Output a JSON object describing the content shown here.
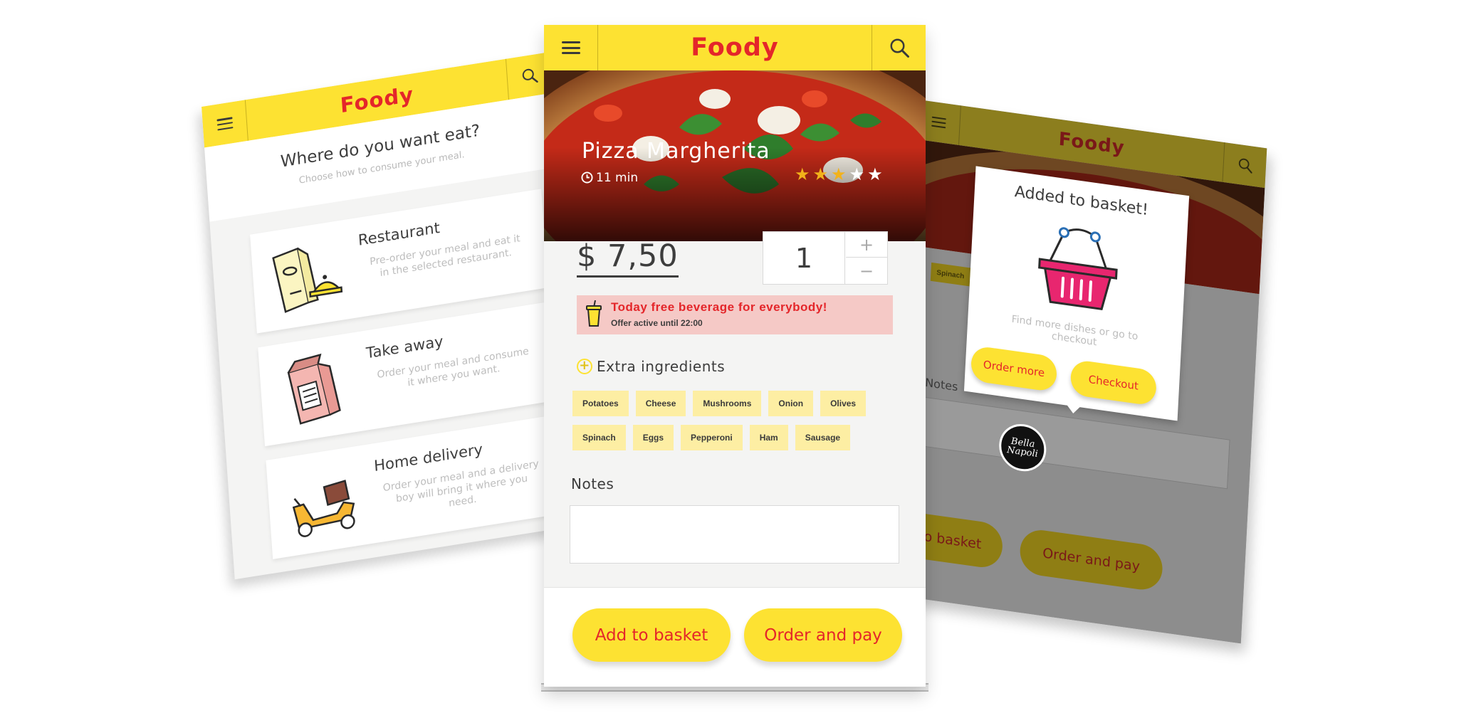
{
  "app": {
    "brand": "Foody"
  },
  "center": {
    "dish_title": "Pizza Margherita",
    "time": "11 min",
    "rating": {
      "value": 3,
      "max": 5
    },
    "price": "$ 7,50",
    "quantity": "1",
    "plus": "+",
    "minus": "−",
    "promo_title": "Today free beverage for everybody!",
    "promo_sub": "Offer active until 22:00",
    "extra_heading": "Extra ingredients",
    "ingredients_row1": [
      "Potatoes",
      "Cheese",
      "Mushrooms",
      "Onion",
      "Olives"
    ],
    "ingredients_row2": [
      "Spinach",
      "Eggs",
      "Pepperoni",
      "Ham",
      "Sausage"
    ],
    "notes_label": "Notes",
    "add_to_basket": "Add to basket",
    "order_and_pay": "Order and pay"
  },
  "left": {
    "question": "Where do you want eat?",
    "question_sub": "Choose how to consume your meal.",
    "options": [
      {
        "title": "Restaurant",
        "desc": "Pre-order your meal and eat it in the selected restaurant.",
        "icon": "menu-cloche-icon"
      },
      {
        "title": "Take away",
        "desc": "Order your meal and consume it where you want.",
        "icon": "paper-bag-icon"
      },
      {
        "title": "Home delivery",
        "desc": "Order your meal and a delivery boy will bring it where you need.",
        "icon": "scooter-icon"
      }
    ]
  },
  "right": {
    "modal_title": "Added to basket!",
    "modal_sub": "Find more dishes or go to checkout",
    "order_more": "Order more",
    "checkout": "Checkout",
    "restaurant_logo": "Bella Napoli",
    "bg_add_to_basket": "Add to basket",
    "bg_order_and_pay": "Order and pay",
    "bg_notes": "Notes"
  },
  "colors": {
    "brand_yellow": "#fde232",
    "brand_red": "#e4262a",
    "chip_bg": "#fdeea3",
    "promo_bg": "#f5c9c6",
    "basket_pink": "#e8266f"
  }
}
